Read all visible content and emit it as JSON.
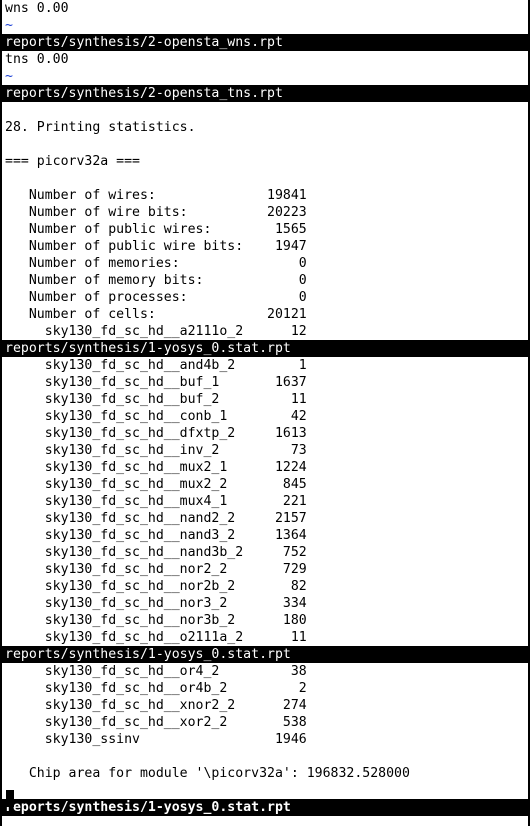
{
  "terminal": {
    "lines": [
      {
        "text": "wns 0.00",
        "kind": "normal"
      },
      {
        "text": "~",
        "kind": "tilde"
      },
      {
        "text": "reports/synthesis/2-opensta_wns.rpt",
        "kind": "bar"
      },
      {
        "text": "tns 0.00",
        "kind": "normal"
      },
      {
        "text": "~",
        "kind": "tilde"
      },
      {
        "text": "reports/synthesis/2-opensta_tns.rpt",
        "kind": "bar"
      },
      {
        "text": "",
        "kind": "normal"
      },
      {
        "text": "28. Printing statistics.",
        "kind": "normal"
      },
      {
        "text": "",
        "kind": "normal"
      },
      {
        "text": "=== picorv32a ===",
        "kind": "normal"
      },
      {
        "text": "",
        "kind": "normal"
      },
      {
        "text": "   Number of wires:              19841",
        "kind": "normal"
      },
      {
        "text": "   Number of wire bits:          20223",
        "kind": "normal"
      },
      {
        "text": "   Number of public wires:        1565",
        "kind": "normal"
      },
      {
        "text": "   Number of public wire bits:    1947",
        "kind": "normal"
      },
      {
        "text": "   Number of memories:               0",
        "kind": "normal"
      },
      {
        "text": "   Number of memory bits:            0",
        "kind": "normal"
      },
      {
        "text": "   Number of processes:              0",
        "kind": "normal"
      },
      {
        "text": "   Number of cells:              20121",
        "kind": "normal"
      },
      {
        "text": "     sky130_fd_sc_hd__a2111o_2      12",
        "kind": "normal"
      },
      {
        "text": "reports/synthesis/1-yosys_0.stat.rpt",
        "kind": "bar"
      },
      {
        "text": "     sky130_fd_sc_hd__and4b_2        1",
        "kind": "normal"
      },
      {
        "text": "     sky130_fd_sc_hd__buf_1       1637",
        "kind": "normal"
      },
      {
        "text": "     sky130_fd_sc_hd__buf_2         11",
        "kind": "normal"
      },
      {
        "text": "     sky130_fd_sc_hd__conb_1        42",
        "kind": "normal"
      },
      {
        "text": "     sky130_fd_sc_hd__dfxtp_2     1613",
        "kind": "normal"
      },
      {
        "text": "     sky130_fd_sc_hd__inv_2         73",
        "kind": "normal"
      },
      {
        "text": "     sky130_fd_sc_hd__mux2_1      1224",
        "kind": "normal"
      },
      {
        "text": "     sky130_fd_sc_hd__mux2_2       845",
        "kind": "normal"
      },
      {
        "text": "     sky130_fd_sc_hd__mux4_1       221",
        "kind": "normal"
      },
      {
        "text": "     sky130_fd_sc_hd__nand2_2     2157",
        "kind": "normal"
      },
      {
        "text": "     sky130_fd_sc_hd__nand3_2     1364",
        "kind": "normal"
      },
      {
        "text": "     sky130_fd_sc_hd__nand3b_2     752",
        "kind": "normal"
      },
      {
        "text": "     sky130_fd_sc_hd__nor2_2       729",
        "kind": "normal"
      },
      {
        "text": "     sky130_fd_sc_hd__nor2b_2       82",
        "kind": "normal"
      },
      {
        "text": "     sky130_fd_sc_hd__nor3_2       334",
        "kind": "normal"
      },
      {
        "text": "     sky130_fd_sc_hd__nor3b_2      180",
        "kind": "normal"
      },
      {
        "text": "     sky130_fd_sc_hd__o2111a_2      11",
        "kind": "normal"
      },
      {
        "text": "reports/synthesis/1-yosys_0.stat.rpt",
        "kind": "bar"
      },
      {
        "text": "     sky130_fd_sc_hd__or4_2         38",
        "kind": "normal"
      },
      {
        "text": "     sky130_fd_sc_hd__or4b_2         2",
        "kind": "normal"
      },
      {
        "text": "     sky130_fd_sc_hd__xnor2_2      274",
        "kind": "normal"
      },
      {
        "text": "     sky130_fd_sc_hd__xor2_2       538",
        "kind": "normal"
      },
      {
        "text": "     sky130_ssinv                 1946",
        "kind": "normal"
      },
      {
        "text": "",
        "kind": "normal"
      },
      {
        "text": "   Chip area for module '\\picorv32a': 196832.528000",
        "kind": "normal"
      },
      {
        "text": "",
        "kind": "normal"
      },
      {
        "text": "reports/synthesis/1-yosys_0.stat.rpt",
        "kind": "bar-bold"
      }
    ]
  },
  "colors": {
    "background": "#ffffff",
    "text": "#000000",
    "tilde": "#1a3fd6",
    "statusbar_bg": "#000000",
    "statusbar_text": "#ffffff"
  }
}
